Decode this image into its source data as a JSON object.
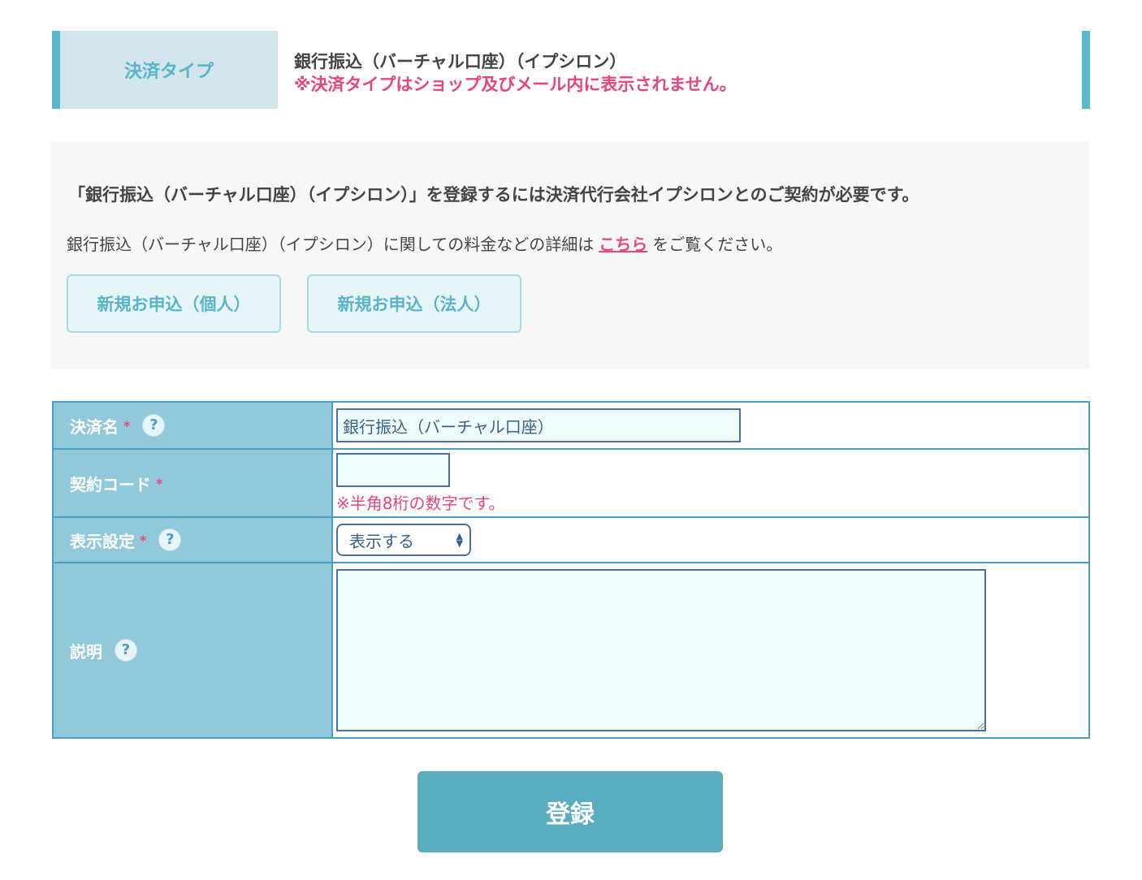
{
  "payment_type": {
    "label": "決済タイプ",
    "value": "銀行振込（バーチャル口座）（イプシロン）",
    "note": "※決済タイプはショップ及びメール内に表示されません。"
  },
  "info": {
    "title": "「銀行振込（バーチャル口座）（イプシロン）」を登録するには決済代行会社イプシロンとのご契約が必要です。",
    "detail_prefix": "銀行振込（バーチャル口座）（イプシロン）に関しての料金などの詳細は",
    "detail_link": "こちら",
    "detail_suffix": "をご覧ください。",
    "apply_personal": "新規お申込（個人）",
    "apply_corporate": "新規お申込（法人）"
  },
  "form": {
    "required_mark": "*",
    "help_icon": "?",
    "payment_name": {
      "label": "決済名",
      "value": "銀行振込（バーチャル口座）"
    },
    "contract_code": {
      "label": "契約コード",
      "value": "",
      "note": "※半角8桁の数字です。"
    },
    "display_setting": {
      "label": "表示設定",
      "selected": "表示する"
    },
    "description": {
      "label": "説明",
      "value": ""
    }
  },
  "submit_label": "登録",
  "colors": {
    "accent": "#5ab8cc",
    "header_cell": "#92c9da",
    "warning": "#e8457a",
    "submit": "#5aacbf"
  }
}
